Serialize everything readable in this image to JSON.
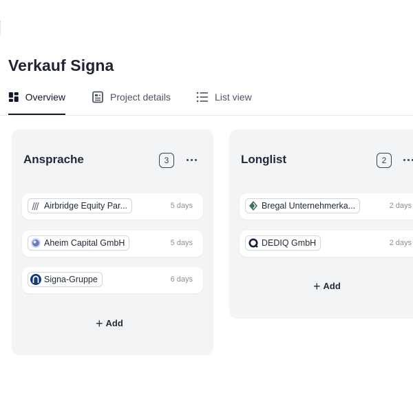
{
  "page": {
    "title": "Verkauf Signa"
  },
  "tabs": [
    {
      "label": "Overview",
      "icon": "dashboard-icon",
      "active": true
    },
    {
      "label": "Project details",
      "icon": "document-icon",
      "active": false
    },
    {
      "label": "List view",
      "icon": "list-icon",
      "active": false
    }
  ],
  "columns": [
    {
      "title": "Ansprache",
      "count": "3",
      "cards": [
        {
          "company": "Airbridge Equity Par...",
          "logo": "airbridge-logo-icon",
          "age": "5 days"
        },
        {
          "company": "Aheim Capital GmbH",
          "logo": "aheim-logo-icon",
          "age": "5 days"
        },
        {
          "company": "Signa-Gruppe",
          "logo": "signa-logo-icon",
          "age": "6 days"
        }
      ],
      "add_label": "Add"
    },
    {
      "title": "Longlist",
      "count": "2",
      "cards": [
        {
          "company": "Bregal Unternehmerka...",
          "logo": "bregal-logo-icon",
          "age": "2 days"
        },
        {
          "company": "DEDIQ GmbH",
          "logo": "dediq-logo-icon",
          "age": "2 days"
        }
      ],
      "add_label": "Add"
    }
  ],
  "colors": {
    "column_bg": "#f3f4f6",
    "text": "#1f2937",
    "muted": "#8a9099"
  }
}
